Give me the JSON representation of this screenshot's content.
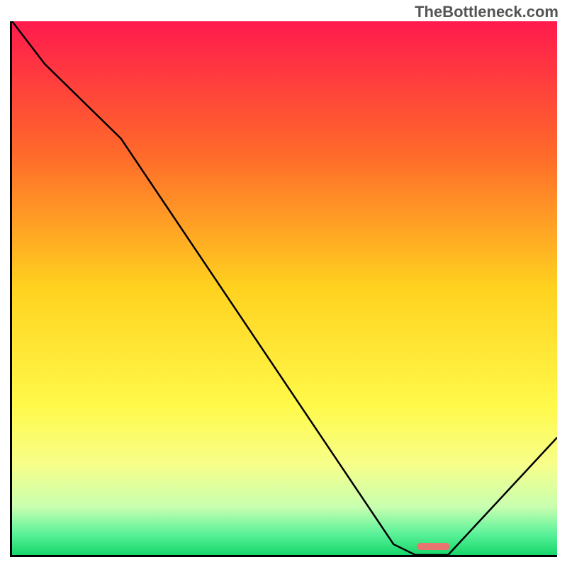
{
  "watermark": "TheBottleneck.com",
  "chart_data": {
    "type": "line",
    "title": "",
    "xlabel": "",
    "ylabel": "",
    "xlim": [
      0,
      100
    ],
    "ylim": [
      0,
      100
    ],
    "gradient_stops": [
      {
        "offset": 0,
        "color": "#ff1a4d"
      },
      {
        "offset": 0.25,
        "color": "#ff6a2a"
      },
      {
        "offset": 0.5,
        "color": "#ffd21f"
      },
      {
        "offset": 0.72,
        "color": "#fff94a"
      },
      {
        "offset": 0.83,
        "color": "#f7ff8a"
      },
      {
        "offset": 0.91,
        "color": "#c8ffb0"
      },
      {
        "offset": 0.96,
        "color": "#5cf29a"
      },
      {
        "offset": 1.0,
        "color": "#17d76a"
      }
    ],
    "series": [
      {
        "name": "bottleneck-curve",
        "x": [
          0,
          6,
          20,
          70,
          74,
          80,
          100
        ],
        "y": [
          100,
          92,
          78,
          2,
          0,
          0,
          22
        ]
      }
    ],
    "marker": {
      "name": "target-range",
      "x_start": 74,
      "x_end": 80,
      "y": 1,
      "color": "#e8746f"
    }
  }
}
